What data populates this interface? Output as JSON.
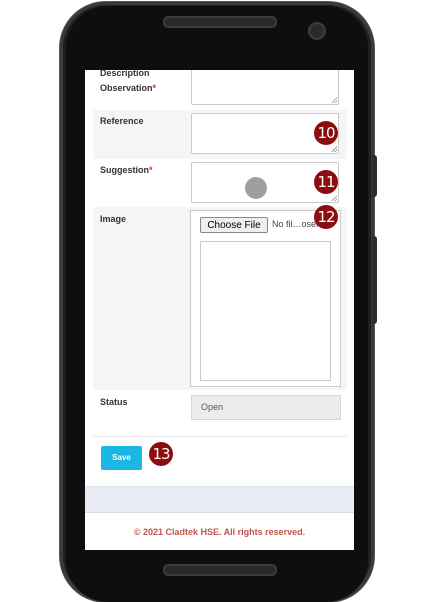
{
  "form": {
    "description_label": "Description",
    "observation_label": "Observation",
    "required_mark": "*",
    "reference_label": "Reference",
    "suggestion_label": "Suggestion",
    "image_label": "Image",
    "status_label": "Status",
    "status_value": "Open",
    "choose_file_label": "Choose File",
    "file_name_text": "No fil…osen",
    "save_label": "Save"
  },
  "badges": {
    "b10": "10",
    "b11": "11",
    "b12": "12",
    "b13": "13"
  },
  "footer": {
    "text": "© 2021 Cladtek HSE. All rights reserved."
  },
  "colors": {
    "accent": "#1ab7e6",
    "badge": "#8b0d0d",
    "footer_text": "#c0554d",
    "required": "#c9302c"
  }
}
